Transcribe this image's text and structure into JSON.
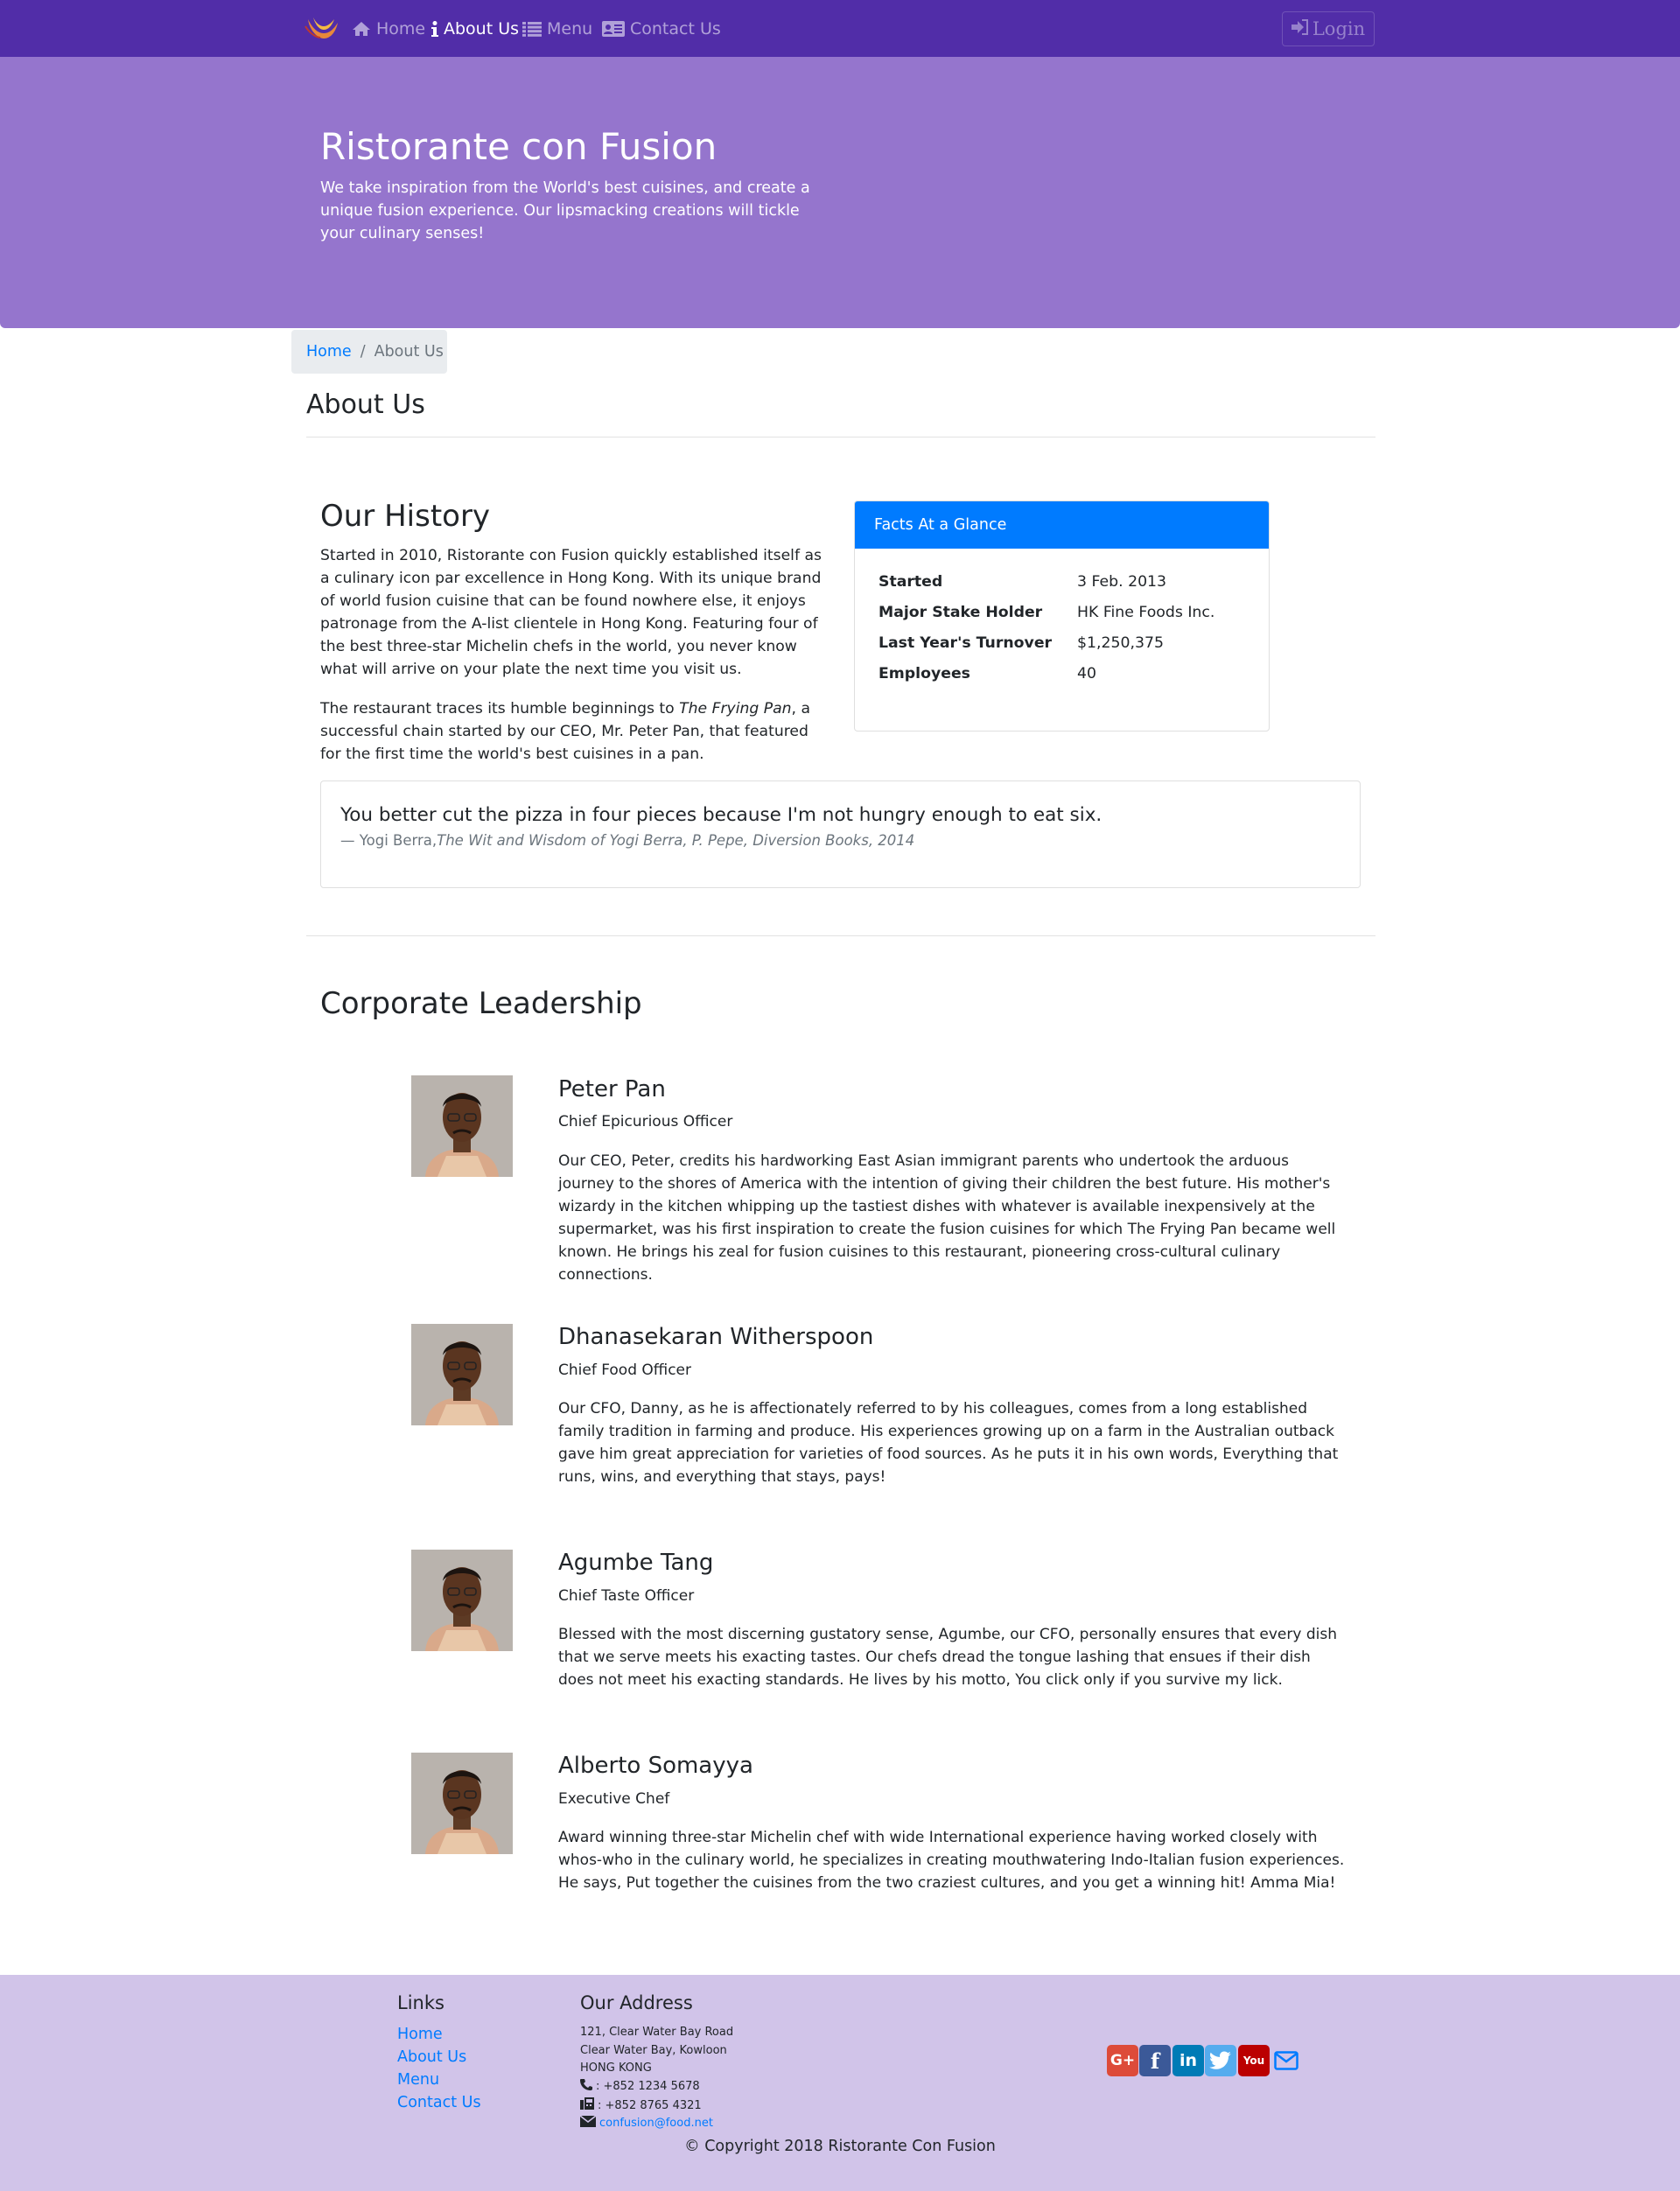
{
  "nav": {
    "brand_logo": "brand-logo",
    "items": [
      {
        "label": "Home",
        "icon": "home-icon"
      },
      {
        "label": "About Us",
        "icon": "info-icon",
        "active": true
      },
      {
        "label": "Menu",
        "icon": "list-icon"
      },
      {
        "label": "Contact Us",
        "icon": "address-card-icon"
      }
    ],
    "login_label": "Login",
    "color": "#512DA8"
  },
  "jumbotron": {
    "title": "Ristorante con Fusion",
    "text": "We take inspiration from the World's best cuisines, and create a unique fusion experience. Our lipsmacking creations will tickle your culinary senses!",
    "color": "#9575CD"
  },
  "breadcrumb": {
    "home": "Home",
    "separator": "/",
    "current": "About Us"
  },
  "page_title": "About Us",
  "history": {
    "title": "Our History",
    "paragraph1": "Started in 2010, Ristorante con Fusion quickly established itself as a culinary icon par excellence in Hong Kong. With its unique brand of world fusion cuisine that can be found nowhere else, it enjoys patronage from the A-list clientele in Hong Kong. Featuring four of the best three-star Michelin chefs in the world, you never know what will arrive on your plate the next time you visit us.",
    "paragraph2_before": "The restaurant traces its humble beginnings to ",
    "paragraph2_italic": "The Frying Pan",
    "paragraph2_after": ", a successful chain started by our CEO, Mr. Peter Pan, that featured for the first time the world's best cuisines in a pan."
  },
  "facts": {
    "header": "Facts At a Glance",
    "rows": [
      {
        "label": "Started",
        "value": "3 Feb. 2013"
      },
      {
        "label": "Major Stake Holder",
        "value": "HK Fine Foods Inc."
      },
      {
        "label": "Last Year's Turnover",
        "value": "$1,250,375"
      },
      {
        "label": "Employees",
        "value": "40"
      }
    ]
  },
  "quote": {
    "text": "You better cut the pizza in four pieces because I'm not hungry enough to eat six.",
    "dash": "—",
    "author": "Yogi Berra,",
    "source": "The Wit and Wisdom of Yogi Berra, P. Pepe, Diversion Books, 2014"
  },
  "leadership": {
    "title": "Corporate Leadership",
    "leaders": [
      {
        "name": "Peter Pan",
        "role": "Chief Epicurious Officer",
        "description": "Our CEO, Peter, credits his hardworking East Asian immigrant parents who undertook the arduous journey to the shores of America with the intention of giving their children the best future. His mother's wizardy in the kitchen whipping up the tastiest dishes with whatever is available inexpensively at the supermarket, was his first inspiration to create the fusion cuisines for which The Frying Pan became well known. He brings his zeal for fusion cuisines to this restaurant, pioneering cross-cultural culinary connections."
      },
      {
        "name": "Dhanasekaran Witherspoon",
        "role": "Chief Food Officer",
        "description": "Our CFO, Danny, as he is affectionately referred to by his colleagues, comes from a long established family tradition in farming and produce. His experiences growing up on a farm in the Australian outback gave him great appreciation for varieties of food sources. As he puts it in his own words, Everything that runs, wins, and everything that stays, pays!"
      },
      {
        "name": "Agumbe Tang",
        "role": "Chief Taste Officer",
        "description": "Blessed with the most discerning gustatory sense, Agumbe, our CFO, personally ensures that every dish that we serve meets his exacting tastes. Our chefs dread the tongue lashing that ensues if their dish does not meet his exacting standards. He lives by his motto, You click only if you survive my lick."
      },
      {
        "name": "Alberto Somayya",
        "role": "Executive Chef",
        "description": "Award winning three-star Michelin chef with wide International experience having worked closely with whos-who in the culinary world, he specializes in creating mouthwatering Indo-Italian fusion experiences. He says, Put together the cuisines from the two craziest cultures, and you get a winning hit! Amma Mia!"
      }
    ]
  },
  "footer": {
    "links_title": "Links",
    "links": [
      "Home",
      "About Us",
      "Menu",
      "Contact Us"
    ],
    "address_title": "Our Address",
    "address_lines": [
      "121, Clear Water Bay Road",
      "Clear Water Bay, Kowloon",
      "HONG KONG"
    ],
    "phone": ": +852 1234 5678",
    "fax": ": +852 8765 4321",
    "email": "confusion@food.net",
    "social": [
      {
        "name": "google-plus-icon",
        "glyph": "G+",
        "color": "#dd4b39"
      },
      {
        "name": "facebook-icon",
        "glyph": "f",
        "color": "#3b5998"
      },
      {
        "name": "linkedin-icon",
        "glyph": "in",
        "color": "#007bb6"
      },
      {
        "name": "twitter-icon",
        "glyph": "t",
        "color": "#55acee"
      },
      {
        "name": "youtube-icon",
        "glyph": "You",
        "color": "#bb0000"
      },
      {
        "name": "envelope-icon",
        "glyph": "",
        "color": "#007bff"
      }
    ],
    "copyright": "© Copyright 2018 Ristorante Con Fusion",
    "color": "#D1C4E9"
  }
}
